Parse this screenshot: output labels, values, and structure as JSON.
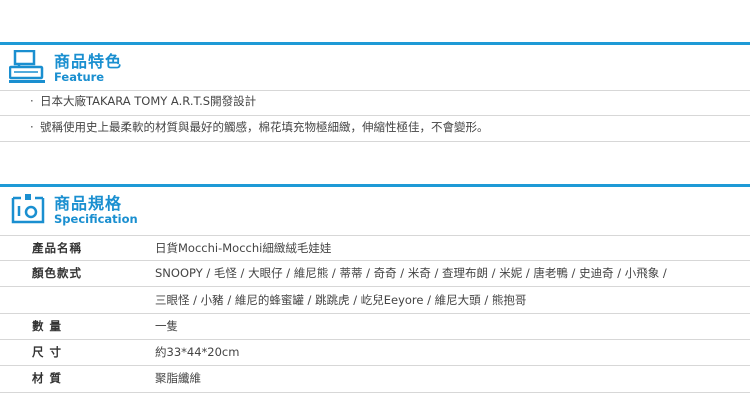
{
  "colors": {
    "accent": "#1e9ad6",
    "divider": "#d7d7d7"
  },
  "feature": {
    "icon": "shop-register-icon",
    "title_zh": "商品特色",
    "title_en": "Feature",
    "items": [
      "日本大廠TAKARA TOMY A.R.T.S開發設計",
      "號稱使用史上最柔軟的材質與最好的觸感，棉花填充物極細緻，伸縮性極佳，不會變形。"
    ]
  },
  "spec": {
    "icon": "tag-icon",
    "title_zh": "商品規格",
    "title_en": "Specification",
    "rows": [
      {
        "label": "產品名稱",
        "value": "日貨Mocchi-Mocchi細緻絨毛娃娃"
      },
      {
        "label": "顏色款式",
        "value": "SNOOPY / 毛怪 / 大眼仔 / 維尼熊 / 蒂蒂 / 奇奇 / 米奇 / 查理布朗 / 米妮 / 唐老鴨 / 史迪奇 / 小飛象 /"
      },
      {
        "label": "",
        "value": "三眼怪 / 小豬 / 維尼的蜂蜜罐 / 跳跳虎 / 屹兒Eeyore / 維尼大頭 / 熊抱哥"
      },
      {
        "label": "數 量",
        "value": "一隻"
      },
      {
        "label": "尺 寸",
        "value": "約33*44*20cm"
      },
      {
        "label": "材 質",
        "value": "聚脂纖維"
      }
    ]
  }
}
